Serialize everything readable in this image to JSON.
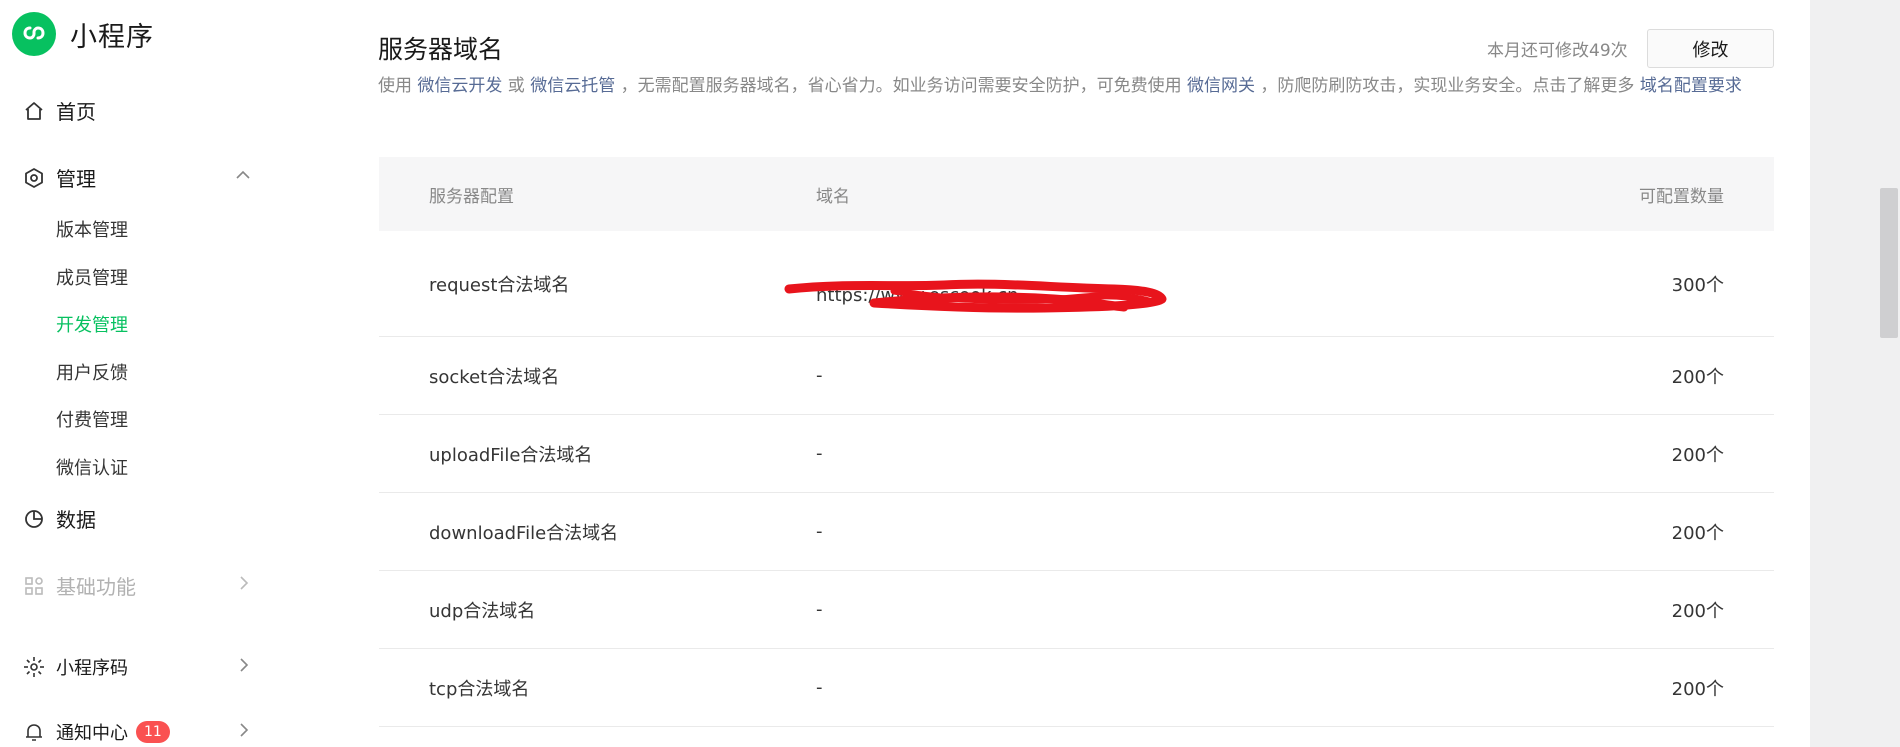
{
  "sidebar": {
    "app_name": "小程序",
    "home": "首页",
    "manage": "管理",
    "manage_items": [
      "版本管理",
      "成员管理",
      "开发管理",
      "用户反馈",
      "付费管理",
      "微信认证"
    ],
    "data": "数据",
    "basic": "基础功能",
    "miniprogram_code": "小程序码",
    "notice_center": "通知中心",
    "notice_count": "11"
  },
  "main": {
    "title": "服务器域名",
    "quota": "本月还可修改49次",
    "modify_label": "修改",
    "desc": {
      "p1": "使用 ",
      "link1": "微信云开发",
      "p2": " 或 ",
      "link2": "微信云托管",
      "p3": " ，无需配置服务器域名，省心省力。如业务访问需要安全防护，可免费使用 ",
      "link3": "微信网关",
      "p4": " ，防爬防刷防攻击，实现业务安全。点击了解更多 ",
      "link4": "域名配置要求"
    },
    "table": {
      "headers": [
        "服务器配置",
        "域名",
        "可配置数量"
      ],
      "rows": [
        {
          "name": "request合法域名",
          "domain": "https://www.escook.cn",
          "count": "300个"
        },
        {
          "name": "socket合法域名",
          "domain": "-",
          "count": "200个"
        },
        {
          "name": "uploadFile合法域名",
          "domain": "-",
          "count": "200个"
        },
        {
          "name": "downloadFile合法域名",
          "domain": "-",
          "count": "200个"
        },
        {
          "name": "udp合法域名",
          "domain": "-",
          "count": "200个"
        },
        {
          "name": "tcp合法域名",
          "domain": "-",
          "count": "200个"
        }
      ]
    }
  },
  "colors": {
    "accent": "#07c160",
    "link": "#576b95",
    "badge": "#fa5151",
    "redaction": "#e8141c"
  }
}
